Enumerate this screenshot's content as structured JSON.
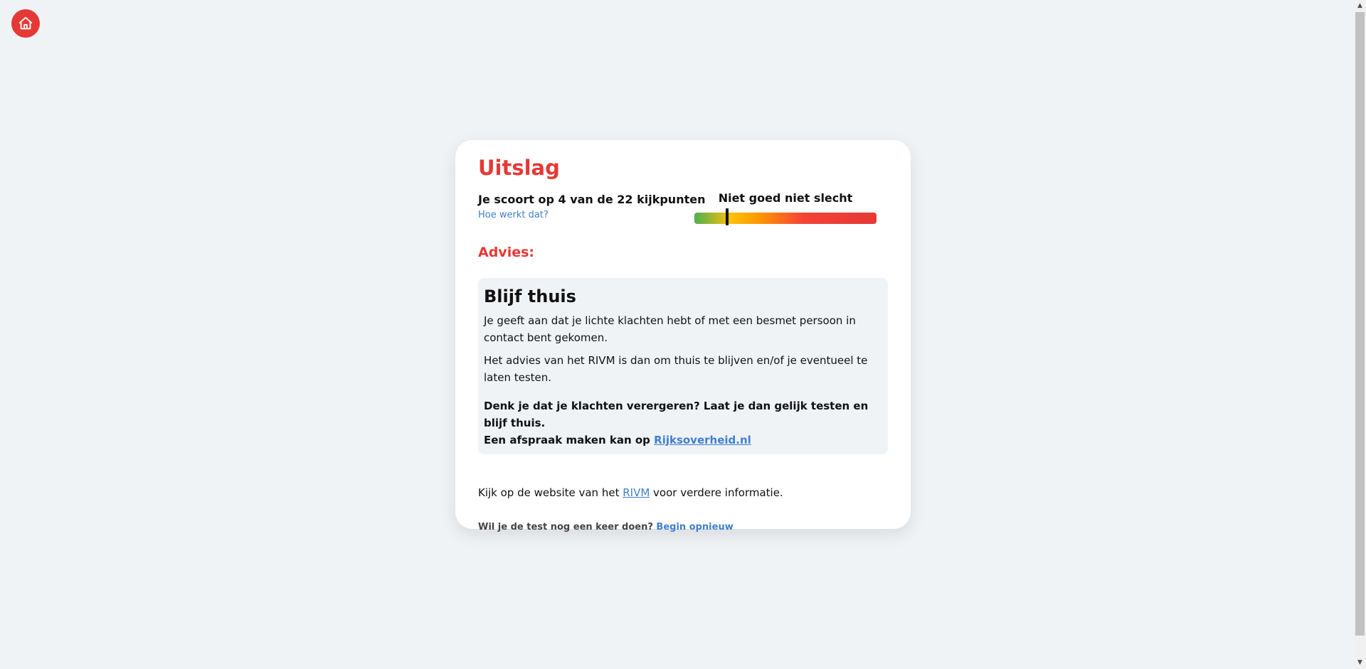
{
  "home": {
    "icon": "home-icon",
    "color": "#e53935"
  },
  "result": {
    "title": "Uitslag",
    "score_text": "Je scoort op 4 van de 22 kijkpunten",
    "score": 4,
    "score_max": 22,
    "how_link": "Hoe werkt dat?",
    "meter_label": "Niet goed niet slecht",
    "meter_level": 0.18
  },
  "advice": {
    "heading": "Advies:",
    "title": "Blijf thuis",
    "p1": "Je geeft aan dat je lichte klachten hebt of met een besmet persoon in contact bent gekomen.",
    "p2": "Het advies van het RIVM is dan om thuis te blijven en/of je eventueel te laten testen.",
    "strong_line1": "Denk je dat je klachten verergeren? Laat je dan gelijk testen en blijf thuis.",
    "strong_line2_prefix": "Een afspraak maken kan op ",
    "strong_link": "Rijksoverheid.nl"
  },
  "info": {
    "prefix": "Kijk op de website van het ",
    "link": "RIVM",
    "suffix": " voor verdere informatie."
  },
  "retry": {
    "question": "Wil je de test nog een keer doen? ",
    "link": "Begin opnieuw"
  },
  "colors": {
    "accent": "#e53935",
    "link": "#3f7fcf",
    "background": "#f0f3f6"
  }
}
